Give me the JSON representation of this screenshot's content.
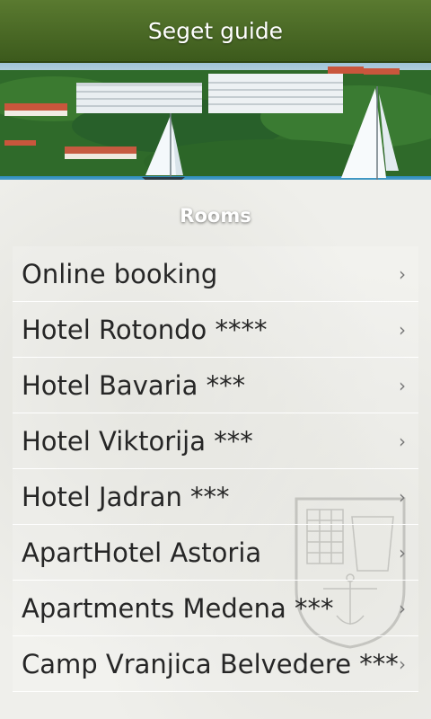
{
  "app": {
    "title": "Seget guide"
  },
  "section": {
    "title": "Rooms"
  },
  "list": {
    "items": [
      {
        "label": "Online booking"
      },
      {
        "label": "Hotel Rotondo ****"
      },
      {
        "label": "Hotel Bavaria ***"
      },
      {
        "label": "Hotel Viktorija ***"
      },
      {
        "label": "Hotel Jadran ***"
      },
      {
        "label": "ApartHotel Astoria"
      },
      {
        "label": "Apartments Medena ***"
      },
      {
        "label": "Camp Vranjica Belvedere ***"
      }
    ],
    "chevron_icon": "chevron-right-icon",
    "chevron_glyph": "›"
  },
  "colors": {
    "titlebar": "#4b6a26",
    "sea": "#2f8fc0",
    "forest": "#2f6a2a"
  }
}
